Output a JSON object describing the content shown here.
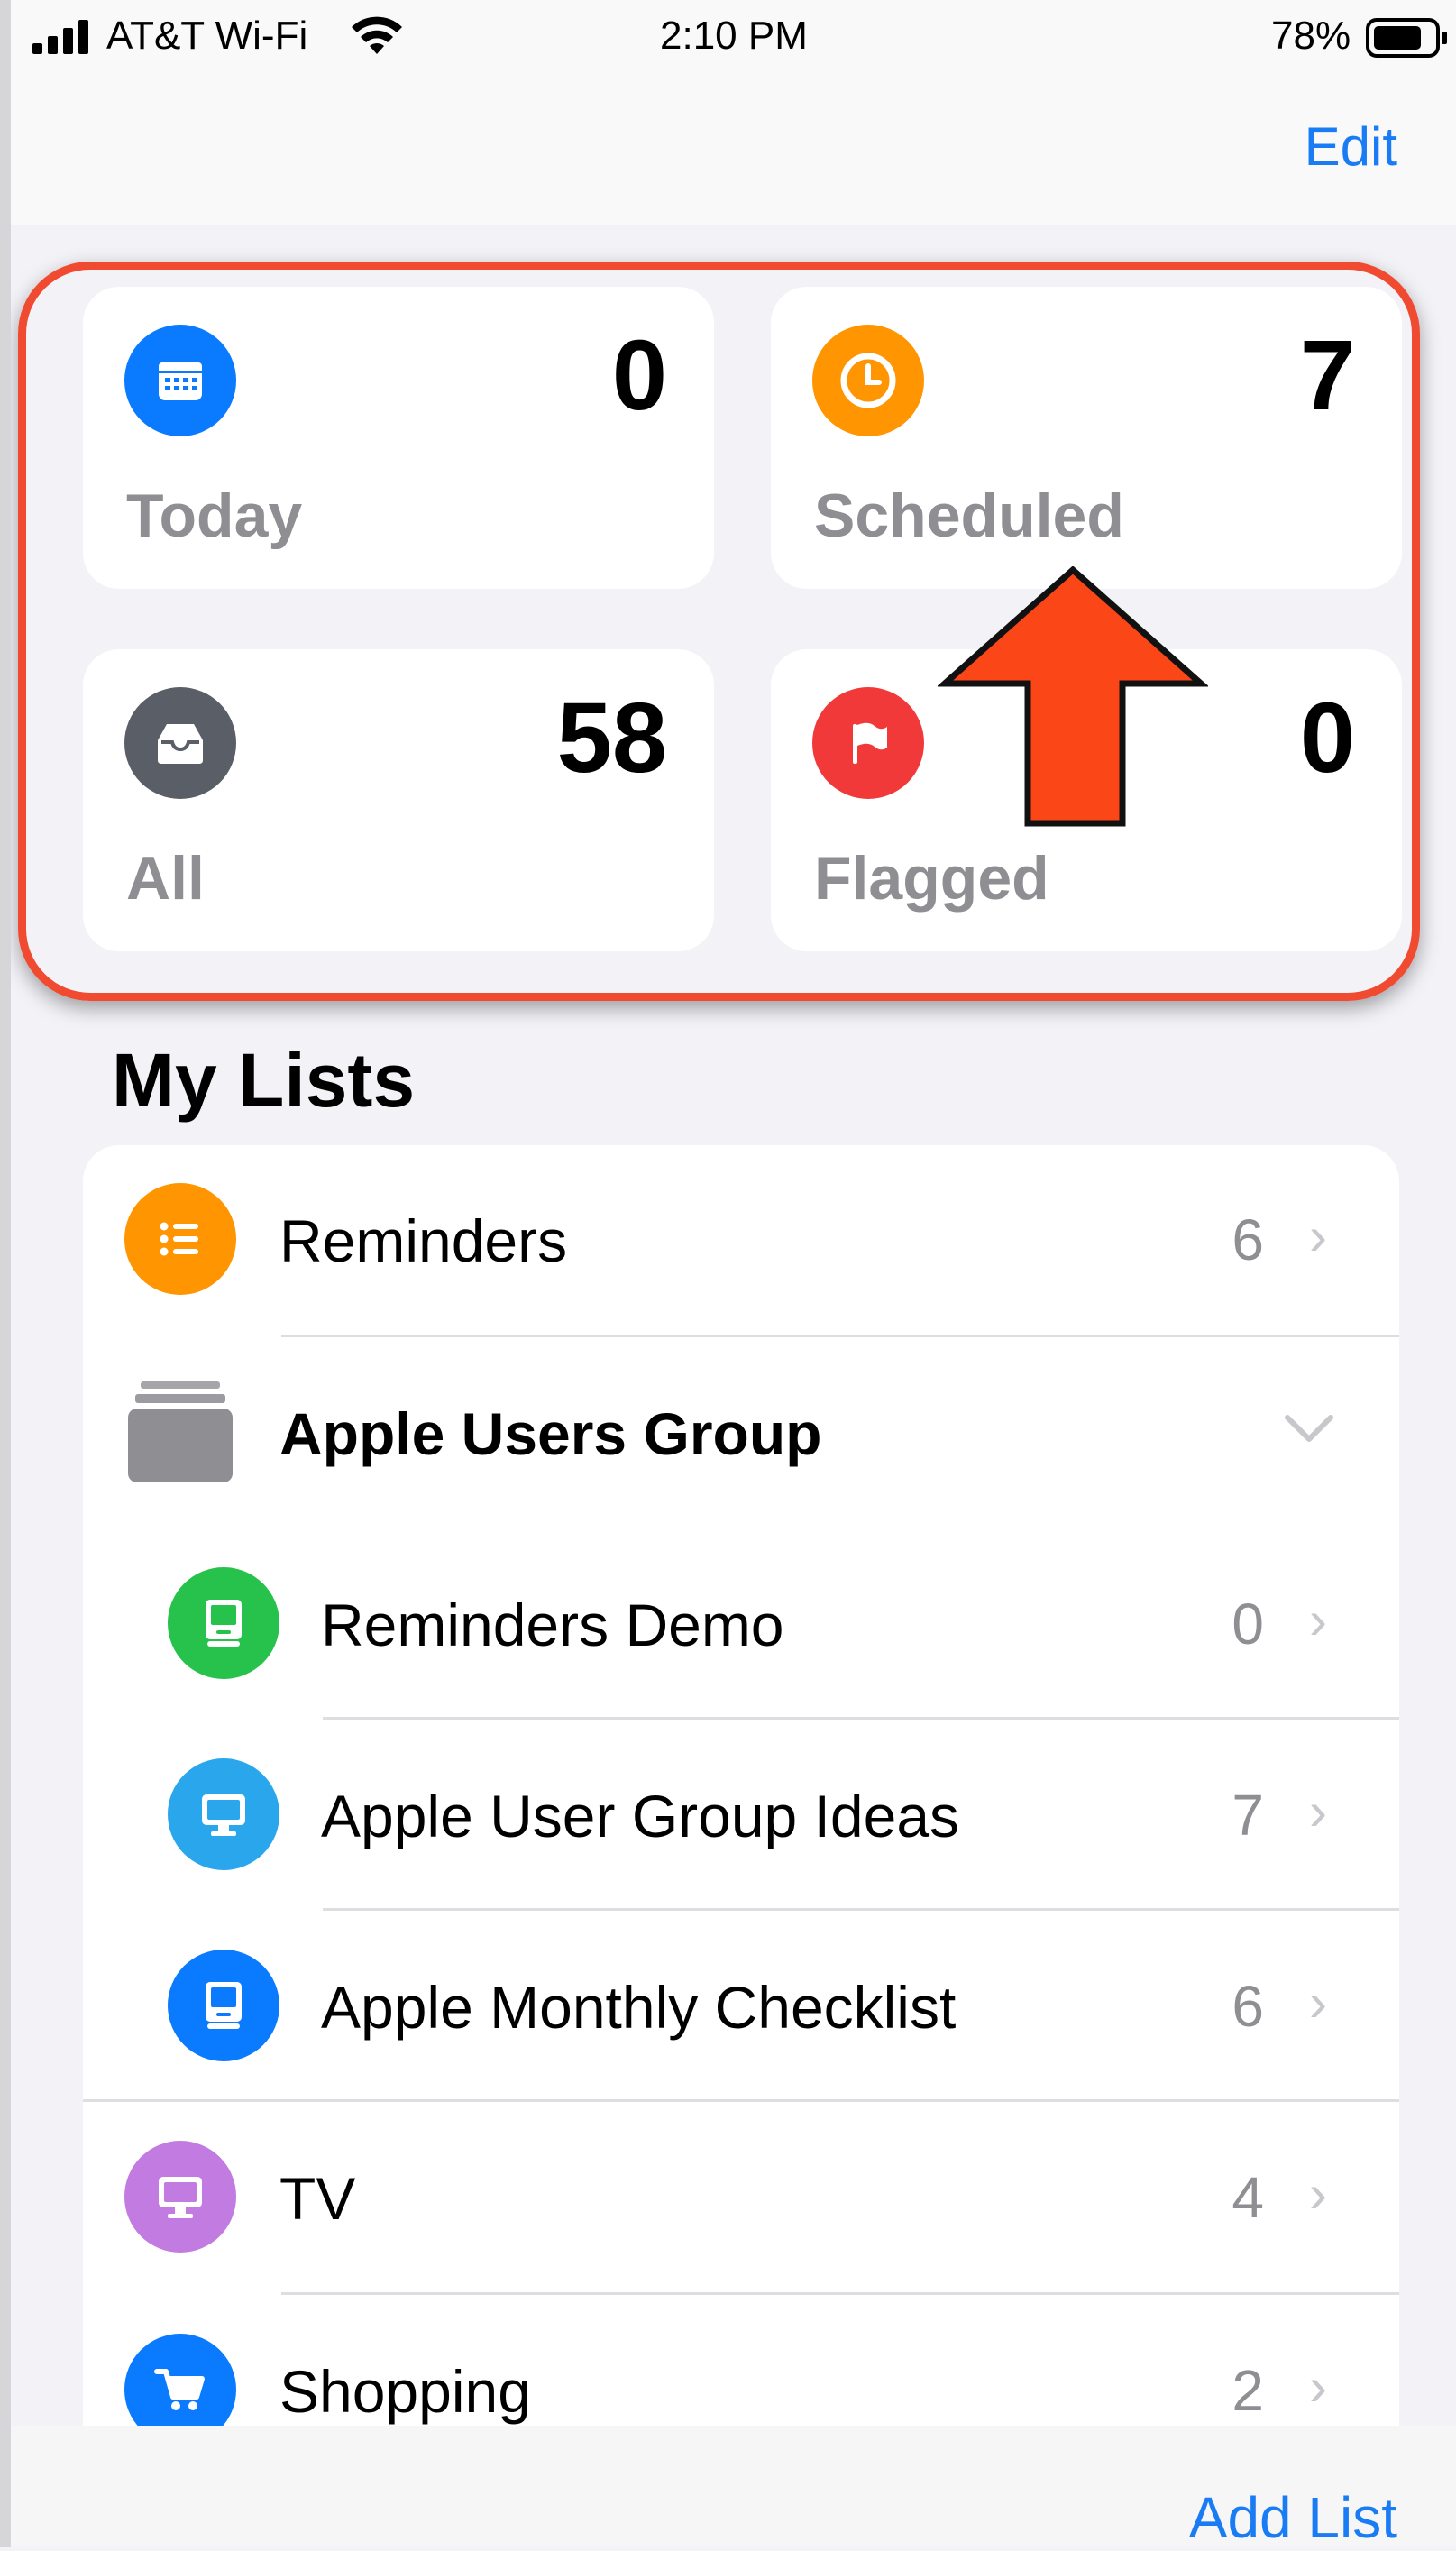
{
  "status_bar": {
    "carrier": "AT&T Wi-Fi",
    "time": "2:10 PM",
    "battery": "78%"
  },
  "nav": {
    "edit_label": "Edit"
  },
  "smart_lists": [
    {
      "label": "Today",
      "count": "0",
      "icon": "calendar-icon",
      "color": "#0a7aff"
    },
    {
      "label": "Scheduled",
      "count": "7",
      "icon": "clock-icon",
      "color": "#ff9500"
    },
    {
      "label": "All",
      "count": "58",
      "icon": "tray-icon",
      "color": "#5a5e66"
    },
    {
      "label": "Flagged",
      "count": "0",
      "icon": "flag-icon",
      "color": "#f2393a"
    }
  ],
  "my_lists": {
    "title": "My Lists",
    "items": [
      {
        "name": "Reminders",
        "count": "6",
        "icon": "list-icon",
        "color": "#ff9500"
      },
      {
        "name": "Apple Users Group",
        "icon": "folder-stack-icon",
        "color": "#8e8e93"
      },
      {
        "name": "Reminders Demo",
        "count": "0",
        "icon": "computer-icon",
        "color": "#27c24c"
      },
      {
        "name": "Apple User Group Ideas",
        "count": "7",
        "icon": "desktop-icon",
        "color": "#2aa6ec"
      },
      {
        "name": "Apple Monthly Checklist",
        "count": "6",
        "icon": "computer-icon",
        "color": "#0a7aff"
      },
      {
        "name": "TV",
        "count": "4",
        "icon": "tv-icon",
        "color": "#c27be0"
      },
      {
        "name": "Shopping",
        "count": "2",
        "icon": "cart-icon",
        "color": "#0a7aff"
      }
    ]
  },
  "footer": {
    "add_list_label": "Add List"
  },
  "annotation": {
    "arrow_color": "#fb4617",
    "box_color": "#f04a30"
  }
}
